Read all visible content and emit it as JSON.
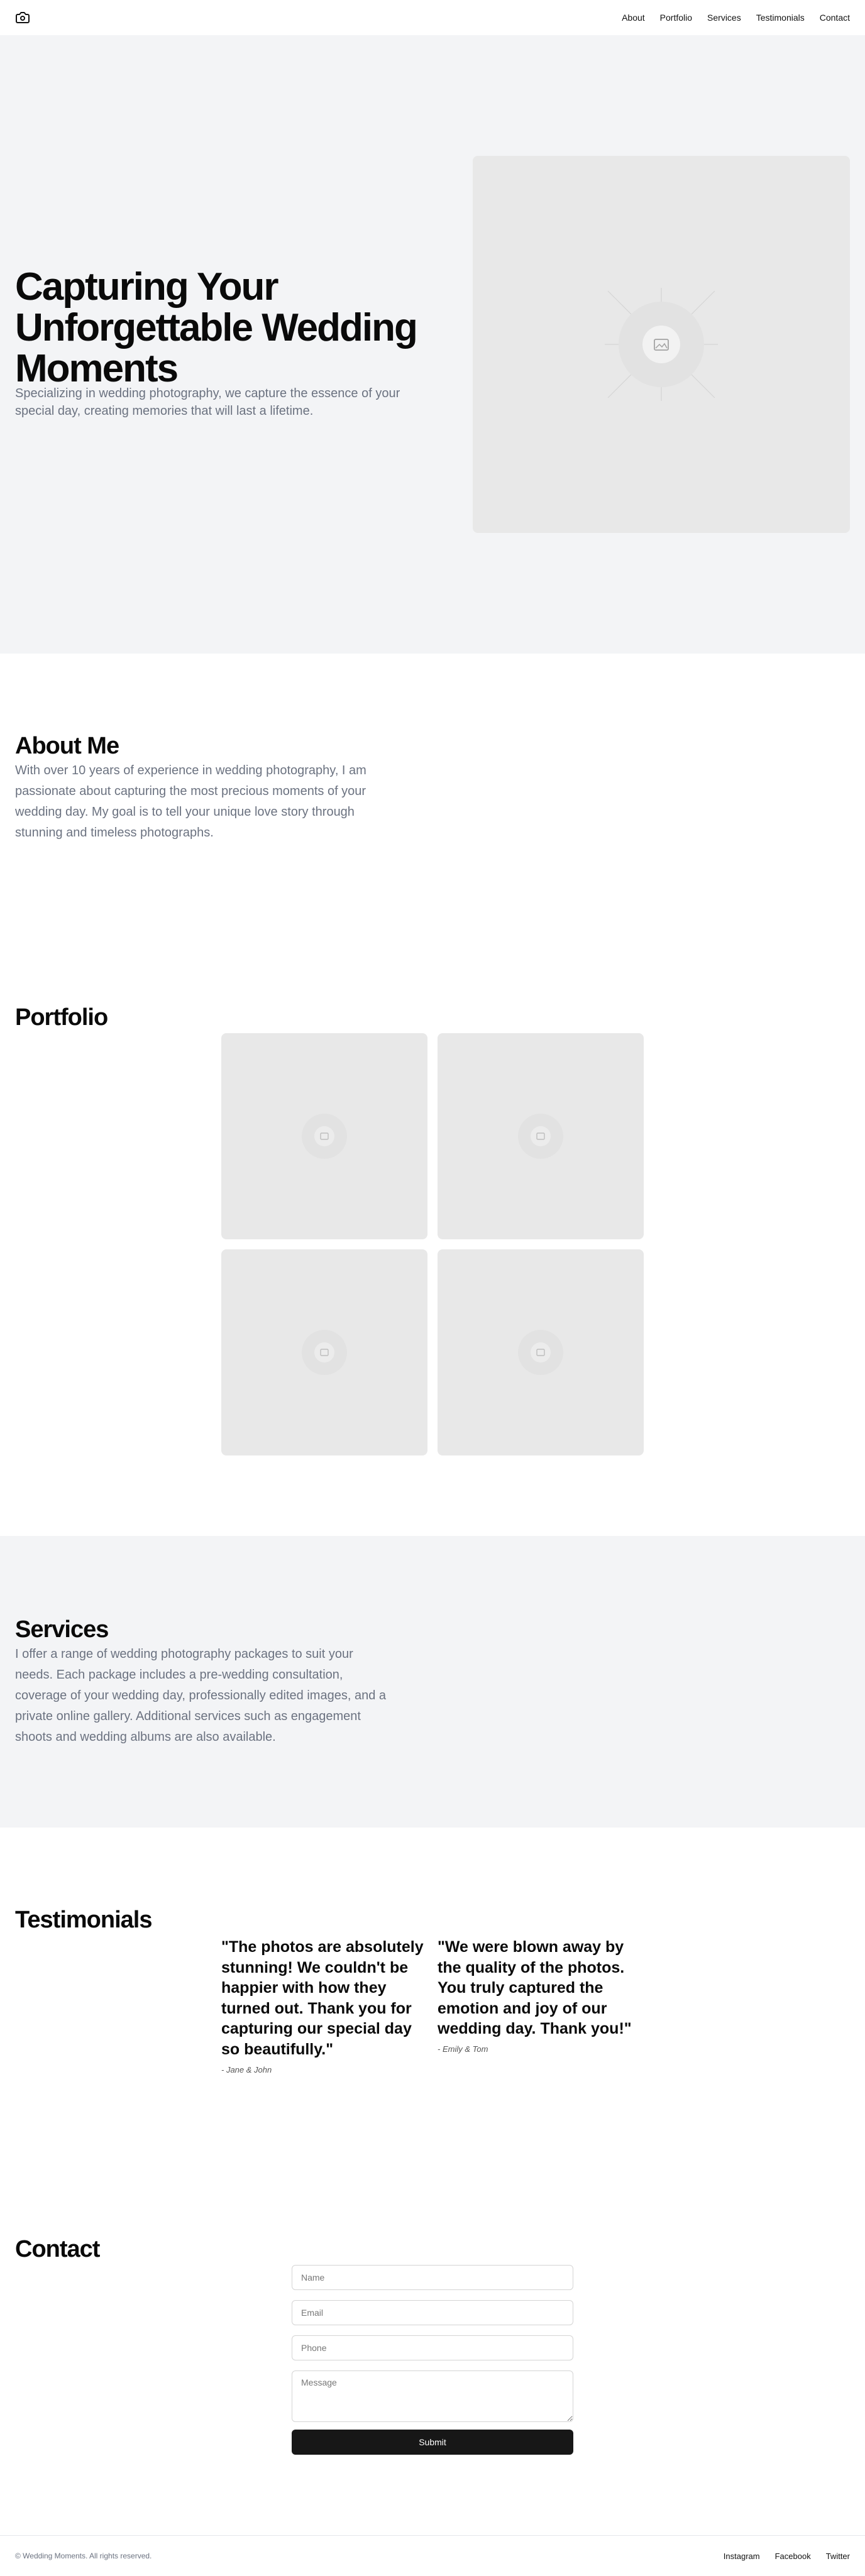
{
  "header": {
    "logo_icon": "camera-icon",
    "nav": [
      {
        "label": "About"
      },
      {
        "label": "Portfolio"
      },
      {
        "label": "Services"
      },
      {
        "label": "Testimonials"
      },
      {
        "label": "Contact"
      }
    ]
  },
  "hero": {
    "title": "Capturing Your Unforgettable Wedding Moments",
    "subtitle": "Specializing in wedding photography, we capture the essence of your special day, creating memories that will last a lifetime.",
    "image_icon": "image-placeholder-icon"
  },
  "about": {
    "title": "About Me",
    "text": "With over 10 years of experience in wedding photography, I am passionate about capturing the most precious moments of your wedding day. My goal is to tell your unique love story through stunning and timeless photographs."
  },
  "portfolio": {
    "title": "Portfolio"
  },
  "services": {
    "title": "Services",
    "text": "I offer a range of wedding photography packages to suit your needs. Each package includes a pre-wedding consultation, coverage of your wedding day, professionally edited images, and a private online gallery. Additional services such as engagement shoots and wedding albums are also available."
  },
  "testimonials": {
    "title": "Testimonials",
    "items": [
      {
        "quote": "\"The photos are absolutely stunning! We couldn't be happier with how they turned out. Thank you for capturing our special day so beautifully.\"",
        "author": "- Jane & John"
      },
      {
        "quote": "\"We were blown away by the quality of the photos. You truly captured the emotion and joy of our wedding day. Thank you!\"",
        "author": "- Emily & Tom"
      }
    ]
  },
  "contact": {
    "title": "Contact",
    "name_placeholder": "Name",
    "email_placeholder": "Email",
    "phone_placeholder": "Phone",
    "message_placeholder": "Message",
    "submit_label": "Submit"
  },
  "footer": {
    "copyright": "© Wedding Moments. All rights reserved.",
    "links": [
      {
        "label": "Instagram"
      },
      {
        "label": "Facebook"
      },
      {
        "label": "Twitter"
      }
    ]
  },
  "colors": {
    "band_bg": "#f3f4f6",
    "placeholder_bg": "#e8e8e8",
    "muted_text": "#6b7280",
    "button_bg": "#171717"
  }
}
